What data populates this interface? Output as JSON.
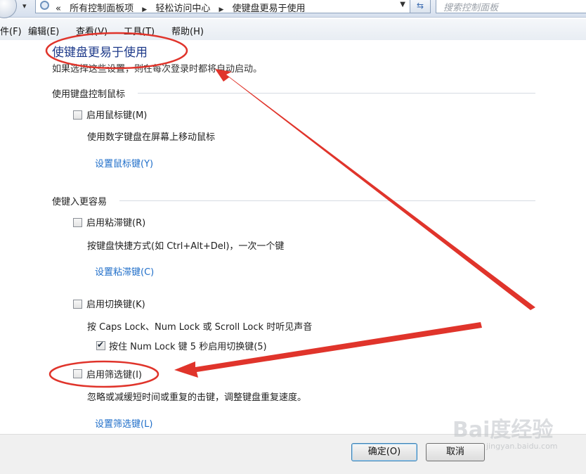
{
  "address_bar": {
    "breadcrumb_prefix": "«",
    "crumbs": [
      "所有控制面板项",
      "轻松访问中心",
      "使键盘更易于使用"
    ],
    "search_placeholder": "搜索控制面板"
  },
  "menu": {
    "file": "件(F)",
    "edit": "编辑(E)",
    "view": "查看(V)",
    "tools": "工具(T)",
    "help": "帮助(H)"
  },
  "page": {
    "title": "使键盘更易于使用",
    "description": "如果选择这些设置，则在每次登录时都将自动启动。"
  },
  "sections": {
    "mouse": {
      "title": "使用键盘控制鼠标",
      "mouse_keys": {
        "label": "启用鼠标键(M)",
        "checked": false,
        "description": "使用数字键盘在屏幕上移动鼠标",
        "link": "设置鼠标键(Y)"
      }
    },
    "typing": {
      "title": "使键入更容易",
      "sticky_keys": {
        "label": "启用粘滞键(R)",
        "checked": false,
        "description": "按键盘快捷方式(如 Ctrl+Alt+Del)，一次一个键",
        "link": "设置粘滞键(C)"
      },
      "toggle_keys": {
        "label": "启用切换键(K)",
        "checked": false,
        "description": "按 Caps Lock、Num Lock 或 Scroll Lock 时听见声音",
        "sub_option": {
          "label": "按住 Num Lock 键 5 秒启用切换键(5)",
          "checked": true
        }
      },
      "filter_keys": {
        "label": "启用筛选键(I)",
        "checked": false,
        "description": "忽略或减缓短时间或重复的击键，调整键盘重复速度。",
        "link": "设置筛选键(L)"
      }
    }
  },
  "footer": {
    "ok": "确定(O)",
    "cancel": "取消"
  },
  "watermark": {
    "text": "Bai度经验",
    "url": "jingyan.baidu.com"
  },
  "annotation_color": "#e0342b"
}
